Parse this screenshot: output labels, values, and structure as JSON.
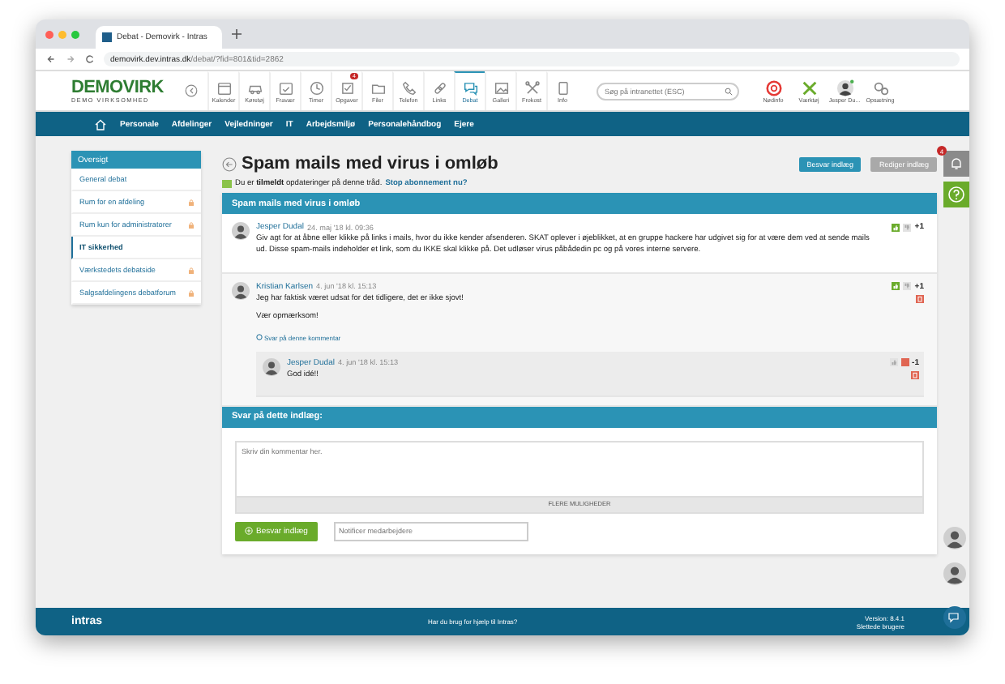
{
  "browser": {
    "tab_title": "Debat - Demovirk - Intras",
    "url": "**demovirk.dev.intras.dk**/debat/?fid=801&tid=2862"
  },
  "header": {
    "logo": "DEMOVIRK",
    "logo_sub": "DEMO VIRKSOMHED",
    "tools": [
      {
        "label": "Kalender",
        "selected": false
      },
      {
        "label": "Køretøj",
        "selected": false
      },
      {
        "label": "Fravær",
        "selected": false
      },
      {
        "label": "Timer",
        "selected": false
      },
      {
        "label": "Opgaver",
        "selected": false,
        "badge": "4"
      },
      {
        "label": "Filer",
        "selected": false
      },
      {
        "label": "Telefon",
        "selected": false
      },
      {
        "label": "Links",
        "selected": false
      },
      {
        "label": "Debat",
        "selected": true
      },
      {
        "label": "Galleri",
        "selected": false
      },
      {
        "label": "Frokost",
        "selected": false
      },
      {
        "label": "Info",
        "selected": false
      }
    ],
    "search": {
      "placeholder": "Søg på intranettet (ESC)"
    },
    "right_tools": [
      {
        "label": "Nødinfo"
      },
      {
        "label": "Værktøj"
      },
      {
        "label": "Jesper Du..."
      },
      {
        "label": "Opsætning"
      }
    ]
  },
  "nav": [
    "Personale",
    "Afdelinger",
    "Vejledninger",
    "IT",
    "Arbejdsmiljø",
    "Personalehåndbog",
    "Ejere"
  ],
  "sidebar": {
    "title": "Oversigt",
    "items": [
      {
        "label": "General debat",
        "selected": false,
        "locked": false
      },
      {
        "label": "Rum for en afdeling",
        "selected": false,
        "locked": true
      },
      {
        "label": "Rum kun for administratorer",
        "selected": false,
        "locked": true
      },
      {
        "label": "IT sikkerhed",
        "selected": true,
        "locked": false
      },
      {
        "label": "Værkstedets debatside",
        "selected": false,
        "locked": true
      },
      {
        "label": "Salgsafdelingens debatforum",
        "selected": false,
        "locked": true
      }
    ]
  },
  "page": {
    "title": "Spam mails med virus i omløb",
    "reply_button": "Besvar indlæg",
    "edit_button": "Rediger indlæg",
    "subscription": "Du er **tilmeldt** opdateringer på denne tråd.",
    "unsubscribe_link": "Stop abonnement nu?"
  },
  "thread": {
    "title": "Spam mails med virus i omløb",
    "posts": [
      {
        "author": "Jesper Dudal",
        "date": "24. maj '18 kl. 09:36",
        "paragraphs": [
          "Giv agt for at åbne eller klikke på links i mails, hvor du ikke kender afsenderen. SKAT oplever i øjeblikket, at en gruppe hackere har udgivet sig for at være dem ved at sende mails ud. Disse spam-mails indeholder et link, som du IKKE skal klikke på. Det udløser virus påbådedin pc og på vores interne servere."
        ],
        "liked": true,
        "disliked": false,
        "score": "+1",
        "deletable": false
      },
      {
        "author": "Kristian Karlsen",
        "date": "4. jun '18 kl. 15:13",
        "paragraphs": [
          "Jeg har faktisk været udsat for det tidligere, det er ikke sjovt!",
          "Vær opmærksom!"
        ],
        "liked": true,
        "disliked": false,
        "score": "+1",
        "deletable": true,
        "reply_link": "Svar på denne kommentar",
        "replies": [
          {
            "author": "Jesper Dudal",
            "date": "4. jun '18 kl. 15:13",
            "paragraphs": [
              "God idé!!"
            ],
            "liked": false,
            "disliked": true,
            "score": "-1",
            "deletable": true
          }
        ]
      }
    ]
  },
  "reply_form": {
    "title": "Svar på dette indlæg:",
    "placeholder": "Skriv din kommentar her.",
    "more": "FLERE MULIGHEDER",
    "submit": "Besvar indlæg",
    "notify_placeholder": "Notificer medarbejdere"
  },
  "notifications": {
    "badge": "4"
  },
  "footer": {
    "logo": "intras",
    "help": "Har du brug for hjælp til Intras?",
    "version": "Version: 8.4.1",
    "deleted_users": "Slettede brugere"
  }
}
